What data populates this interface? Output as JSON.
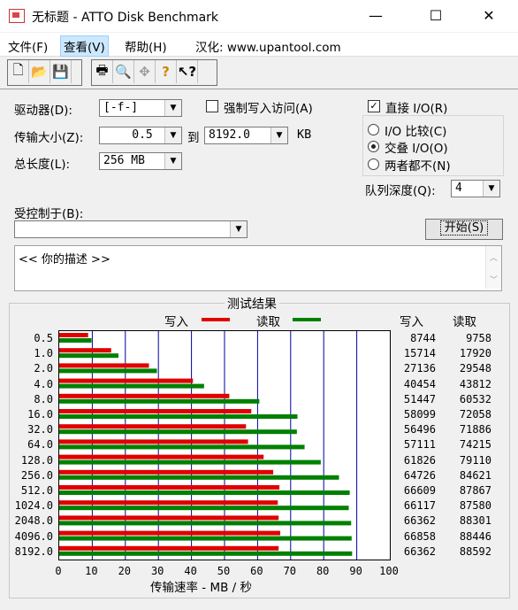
{
  "window": {
    "title": "无标题 - ATTO Disk Benchmark",
    "minimize": "—",
    "maximize": "☐",
    "close": "✕"
  },
  "menu": {
    "file": "文件(F)",
    "view": "查看(V)",
    "help": "帮助(H)",
    "credit": "汉化: www.upantool.com"
  },
  "toolbar": {
    "group1": [
      "new-icon",
      "open-icon",
      "save-icon"
    ],
    "group2": [
      "print-icon",
      "print-preview-icon",
      "move-icon",
      "help-icon",
      "context-help-icon"
    ]
  },
  "form": {
    "drive_label": "驱动器(D):",
    "drive_value": "[-f-]",
    "transfer_label": "传输大小(Z):",
    "transfer_from": "0.5",
    "transfer_to_label": "到",
    "transfer_to": "8192.0",
    "transfer_unit": "KB",
    "total_label": "总长度(L):",
    "total_value": "256 MB",
    "force_write_label": "强制写入访问(A)",
    "direct_io_label": "直接 I/O(R)",
    "io_compare_label": "I/O 比较(C)",
    "overlap_label": "交叠 I/O(O)",
    "neither_label": "两者都不(N)",
    "queue_label": "队列深度(Q):",
    "queue_value": "4",
    "controlled_label": "受控制于(B):",
    "start_button": "开始(S)",
    "description": "<<  你的描述  >>"
  },
  "results": {
    "title": "测试结果",
    "legend_write": "写入",
    "legend_read": "读取",
    "col_write": "写入",
    "col_read": "读取",
    "xlabel": "传输速率 - MB / 秒"
  },
  "colors": {
    "write": "#e00000",
    "read": "#008000",
    "grid": "#0000a0"
  },
  "chart_data": {
    "type": "bar",
    "orientation": "horizontal",
    "categories": [
      "0.5",
      "1.0",
      "2.0",
      "4.0",
      "8.0",
      "16.0",
      "32.0",
      "64.0",
      "128.0",
      "256.0",
      "512.0",
      "1024.0",
      "2048.0",
      "4096.0",
      "8192.0"
    ],
    "series": [
      {
        "name": "写入",
        "values": [
          8744,
          15714,
          27136,
          40454,
          51447,
          58099,
          56496,
          57111,
          61826,
          64726,
          66609,
          66117,
          66362,
          66858,
          66362
        ]
      },
      {
        "name": "读取",
        "values": [
          9758,
          17920,
          29548,
          43812,
          60532,
          72058,
          71886,
          74215,
          79110,
          84621,
          87867,
          87580,
          88301,
          88446,
          88592
        ]
      }
    ],
    "xticks": [
      "0",
      "10",
      "20",
      "30",
      "40",
      "50",
      "60",
      "70",
      "80",
      "90",
      "100"
    ],
    "xlim": [
      0,
      100
    ],
    "xlabel": "传输速率 - MB / 秒",
    "grid": true
  }
}
